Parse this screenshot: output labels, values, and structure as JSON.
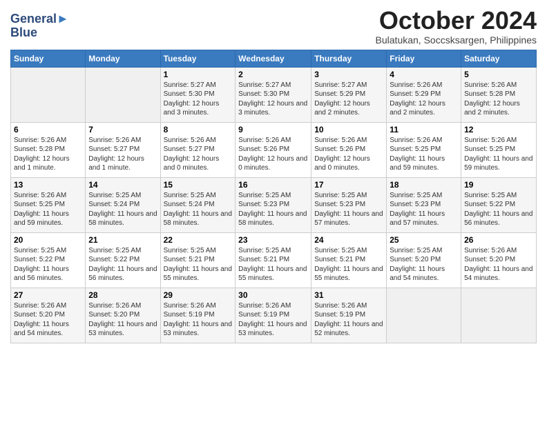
{
  "header": {
    "logo_line1": "General",
    "logo_line2": "Blue",
    "month": "October 2024",
    "location": "Bulatukan, Soccsksargen, Philippines"
  },
  "days_of_week": [
    "Sunday",
    "Monday",
    "Tuesday",
    "Wednesday",
    "Thursday",
    "Friday",
    "Saturday"
  ],
  "weeks": [
    [
      {
        "day": "",
        "info": ""
      },
      {
        "day": "",
        "info": ""
      },
      {
        "day": "1",
        "info": "Sunrise: 5:27 AM\nSunset: 5:30 PM\nDaylight: 12 hours and 3 minutes."
      },
      {
        "day": "2",
        "info": "Sunrise: 5:27 AM\nSunset: 5:30 PM\nDaylight: 12 hours and 3 minutes."
      },
      {
        "day": "3",
        "info": "Sunrise: 5:27 AM\nSunset: 5:29 PM\nDaylight: 12 hours and 2 minutes."
      },
      {
        "day": "4",
        "info": "Sunrise: 5:26 AM\nSunset: 5:29 PM\nDaylight: 12 hours and 2 minutes."
      },
      {
        "day": "5",
        "info": "Sunrise: 5:26 AM\nSunset: 5:28 PM\nDaylight: 12 hours and 2 minutes."
      }
    ],
    [
      {
        "day": "6",
        "info": "Sunrise: 5:26 AM\nSunset: 5:28 PM\nDaylight: 12 hours and 1 minute."
      },
      {
        "day": "7",
        "info": "Sunrise: 5:26 AM\nSunset: 5:27 PM\nDaylight: 12 hours and 1 minute."
      },
      {
        "day": "8",
        "info": "Sunrise: 5:26 AM\nSunset: 5:27 PM\nDaylight: 12 hours and 0 minutes."
      },
      {
        "day": "9",
        "info": "Sunrise: 5:26 AM\nSunset: 5:26 PM\nDaylight: 12 hours and 0 minutes."
      },
      {
        "day": "10",
        "info": "Sunrise: 5:26 AM\nSunset: 5:26 PM\nDaylight: 12 hours and 0 minutes."
      },
      {
        "day": "11",
        "info": "Sunrise: 5:26 AM\nSunset: 5:25 PM\nDaylight: 11 hours and 59 minutes."
      },
      {
        "day": "12",
        "info": "Sunrise: 5:26 AM\nSunset: 5:25 PM\nDaylight: 11 hours and 59 minutes."
      }
    ],
    [
      {
        "day": "13",
        "info": "Sunrise: 5:26 AM\nSunset: 5:25 PM\nDaylight: 11 hours and 59 minutes."
      },
      {
        "day": "14",
        "info": "Sunrise: 5:25 AM\nSunset: 5:24 PM\nDaylight: 11 hours and 58 minutes."
      },
      {
        "day": "15",
        "info": "Sunrise: 5:25 AM\nSunset: 5:24 PM\nDaylight: 11 hours and 58 minutes."
      },
      {
        "day": "16",
        "info": "Sunrise: 5:25 AM\nSunset: 5:23 PM\nDaylight: 11 hours and 58 minutes."
      },
      {
        "day": "17",
        "info": "Sunrise: 5:25 AM\nSunset: 5:23 PM\nDaylight: 11 hours and 57 minutes."
      },
      {
        "day": "18",
        "info": "Sunrise: 5:25 AM\nSunset: 5:23 PM\nDaylight: 11 hours and 57 minutes."
      },
      {
        "day": "19",
        "info": "Sunrise: 5:25 AM\nSunset: 5:22 PM\nDaylight: 11 hours and 56 minutes."
      }
    ],
    [
      {
        "day": "20",
        "info": "Sunrise: 5:25 AM\nSunset: 5:22 PM\nDaylight: 11 hours and 56 minutes."
      },
      {
        "day": "21",
        "info": "Sunrise: 5:25 AM\nSunset: 5:22 PM\nDaylight: 11 hours and 56 minutes."
      },
      {
        "day": "22",
        "info": "Sunrise: 5:25 AM\nSunset: 5:21 PM\nDaylight: 11 hours and 55 minutes."
      },
      {
        "day": "23",
        "info": "Sunrise: 5:25 AM\nSunset: 5:21 PM\nDaylight: 11 hours and 55 minutes."
      },
      {
        "day": "24",
        "info": "Sunrise: 5:25 AM\nSunset: 5:21 PM\nDaylight: 11 hours and 55 minutes."
      },
      {
        "day": "25",
        "info": "Sunrise: 5:25 AM\nSunset: 5:20 PM\nDaylight: 11 hours and 54 minutes."
      },
      {
        "day": "26",
        "info": "Sunrise: 5:26 AM\nSunset: 5:20 PM\nDaylight: 11 hours and 54 minutes."
      }
    ],
    [
      {
        "day": "27",
        "info": "Sunrise: 5:26 AM\nSunset: 5:20 PM\nDaylight: 11 hours and 54 minutes."
      },
      {
        "day": "28",
        "info": "Sunrise: 5:26 AM\nSunset: 5:20 PM\nDaylight: 11 hours and 53 minutes."
      },
      {
        "day": "29",
        "info": "Sunrise: 5:26 AM\nSunset: 5:19 PM\nDaylight: 11 hours and 53 minutes."
      },
      {
        "day": "30",
        "info": "Sunrise: 5:26 AM\nSunset: 5:19 PM\nDaylight: 11 hours and 53 minutes."
      },
      {
        "day": "31",
        "info": "Sunrise: 5:26 AM\nSunset: 5:19 PM\nDaylight: 11 hours and 52 minutes."
      },
      {
        "day": "",
        "info": ""
      },
      {
        "day": "",
        "info": ""
      }
    ]
  ]
}
